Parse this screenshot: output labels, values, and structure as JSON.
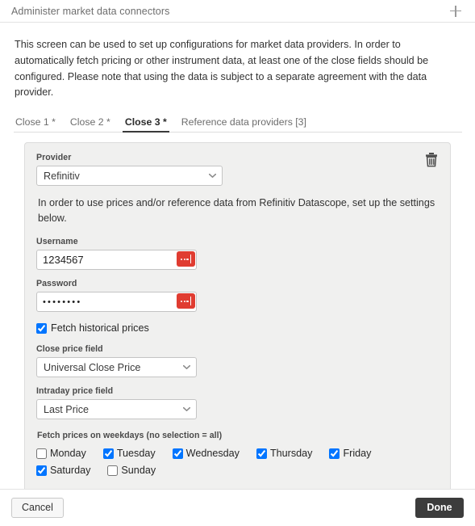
{
  "window": {
    "title": "Administer market data connectors",
    "add_icon": "plus-icon"
  },
  "intro": "This screen can be used to set up configurations for market data providers. In order to automatically fetch pricing or other instrument data, at least one of the close fields should be configured. Please note that using the data is subject to a separate agreement with the data provider.",
  "tabs": [
    {
      "label": "Close 1 *",
      "active": false
    },
    {
      "label": "Close 2 *",
      "active": false
    },
    {
      "label": "Close 3 *",
      "active": true
    },
    {
      "label": "Reference data providers [3]",
      "active": false
    }
  ],
  "panel": {
    "provider_label": "Provider",
    "provider_value": "Refinitiv",
    "delete_icon": "trash-icon",
    "note": "In order to use prices and/or reference data from Refinitiv Datascope, set up the settings below.",
    "username_label": "Username",
    "username_value": "1234567",
    "password_label": "Password",
    "password_value": "••••••••",
    "secret_button_icon": "ellipsis-icon",
    "fetch_historical_label": "Fetch historical prices",
    "fetch_historical_checked": true,
    "close_price_label": "Close price field",
    "close_price_value": "Universal Close Price",
    "intraday_price_label": "Intraday price field",
    "intraday_price_value": "Last Price",
    "weekdays_label": "Fetch prices on weekdays (no selection = all)",
    "weekdays": [
      {
        "label": "Monday",
        "checked": false
      },
      {
        "label": "Tuesday",
        "checked": true
      },
      {
        "label": "Wednesday",
        "checked": true
      },
      {
        "label": "Thursday",
        "checked": true
      },
      {
        "label": "Friday",
        "checked": true
      },
      {
        "label": "Saturday",
        "checked": true
      },
      {
        "label": "Sunday",
        "checked": false
      }
    ]
  },
  "footer": {
    "cancel_label": "Cancel",
    "done_label": "Done"
  },
  "colors": {
    "accent_red": "#e03c31",
    "primary_button": "#3c3c3c",
    "panel_bg": "#f0f0ef",
    "text": "#333333"
  }
}
